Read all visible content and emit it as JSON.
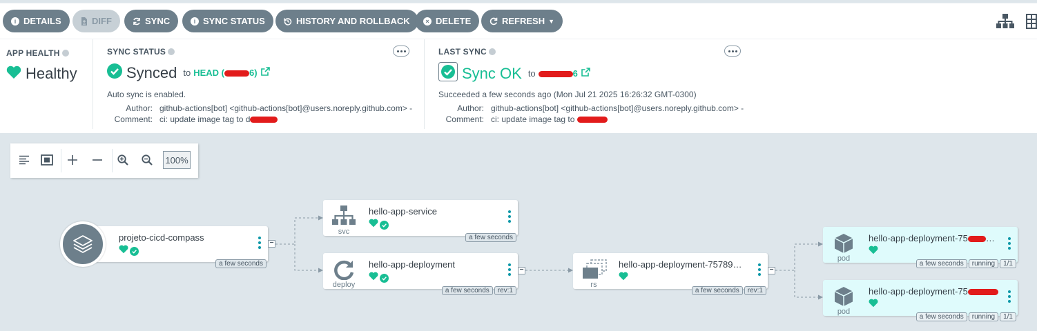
{
  "toolbar": {
    "buttons": [
      {
        "label": "DETAILS",
        "icon": "info-icon"
      },
      {
        "label": "DIFF",
        "icon": "file-diff-icon",
        "disabled": true
      },
      {
        "label": "SYNC",
        "icon": "sync-icon"
      },
      {
        "label": "SYNC STATUS",
        "icon": "info-icon"
      },
      {
        "label": "HISTORY AND ROLLBACK",
        "icon": "history-icon"
      },
      {
        "label": "DELETE",
        "icon": "times-circle-icon"
      },
      {
        "label": "REFRESH",
        "icon": "redo-icon",
        "dropdown": true
      }
    ],
    "view_icons": [
      "network-tree-icon",
      "grid-view-icon"
    ]
  },
  "app_health": {
    "title": "APP HEALTH",
    "status": "Healthy",
    "icon": "heart-icon"
  },
  "sync_status": {
    "title": "SYNC STATUS",
    "status": "Synced",
    "to_label": "to",
    "revision": "HEAD (",
    "revision_tail": "6)",
    "auto_sync": "Auto sync is enabled.",
    "author_label": "Author:",
    "author": "github-actions[bot] <github-actions[bot]@users.noreply.github.com> -",
    "comment_label": "Comment:",
    "comment": "ci: update image tag to d"
  },
  "last_sync": {
    "title": "LAST SYNC",
    "status": "Sync OK",
    "to_label": "to",
    "revision_tail": "6",
    "result": "Succeeded a few seconds ago (Mon Jul 21 2025 16:26:32 GMT-0300)",
    "author_label": "Author:",
    "author": "github-actions[bot] <github-actions[bot]@users.noreply.github.com> -",
    "comment_label": "Comment:",
    "comment": "ci: update image tag to"
  },
  "graph_controls": {
    "zoom": "100%"
  },
  "nodes": {
    "app": {
      "name": "projeto-cicd-compass",
      "age": "a few seconds"
    },
    "service": {
      "name": "hello-app-service",
      "kind": "svc",
      "age": "a few seconds"
    },
    "deployment": {
      "name": "hello-app-deployment",
      "kind": "deploy",
      "age": "a few seconds",
      "rev": "rev:1"
    },
    "replicaset": {
      "name": "hello-app-deployment-75789…",
      "kind": "rs",
      "age": "a few seconds",
      "rev": "rev:1"
    },
    "pod1": {
      "name": "hello-app-deployment-75",
      "name_tail": "…",
      "kind": "pod",
      "age": "a few seconds",
      "state": "running",
      "ready": "1/1"
    },
    "pod2": {
      "name": "hello-app-deployment-75",
      "kind": "pod",
      "age": "a few seconds",
      "state": "running",
      "ready": "1/1"
    }
  },
  "colors": {
    "accent": "#18be94",
    "button": "#6d7f8b",
    "teal": "#0d98a8",
    "canvas": "#dee6eb"
  }
}
